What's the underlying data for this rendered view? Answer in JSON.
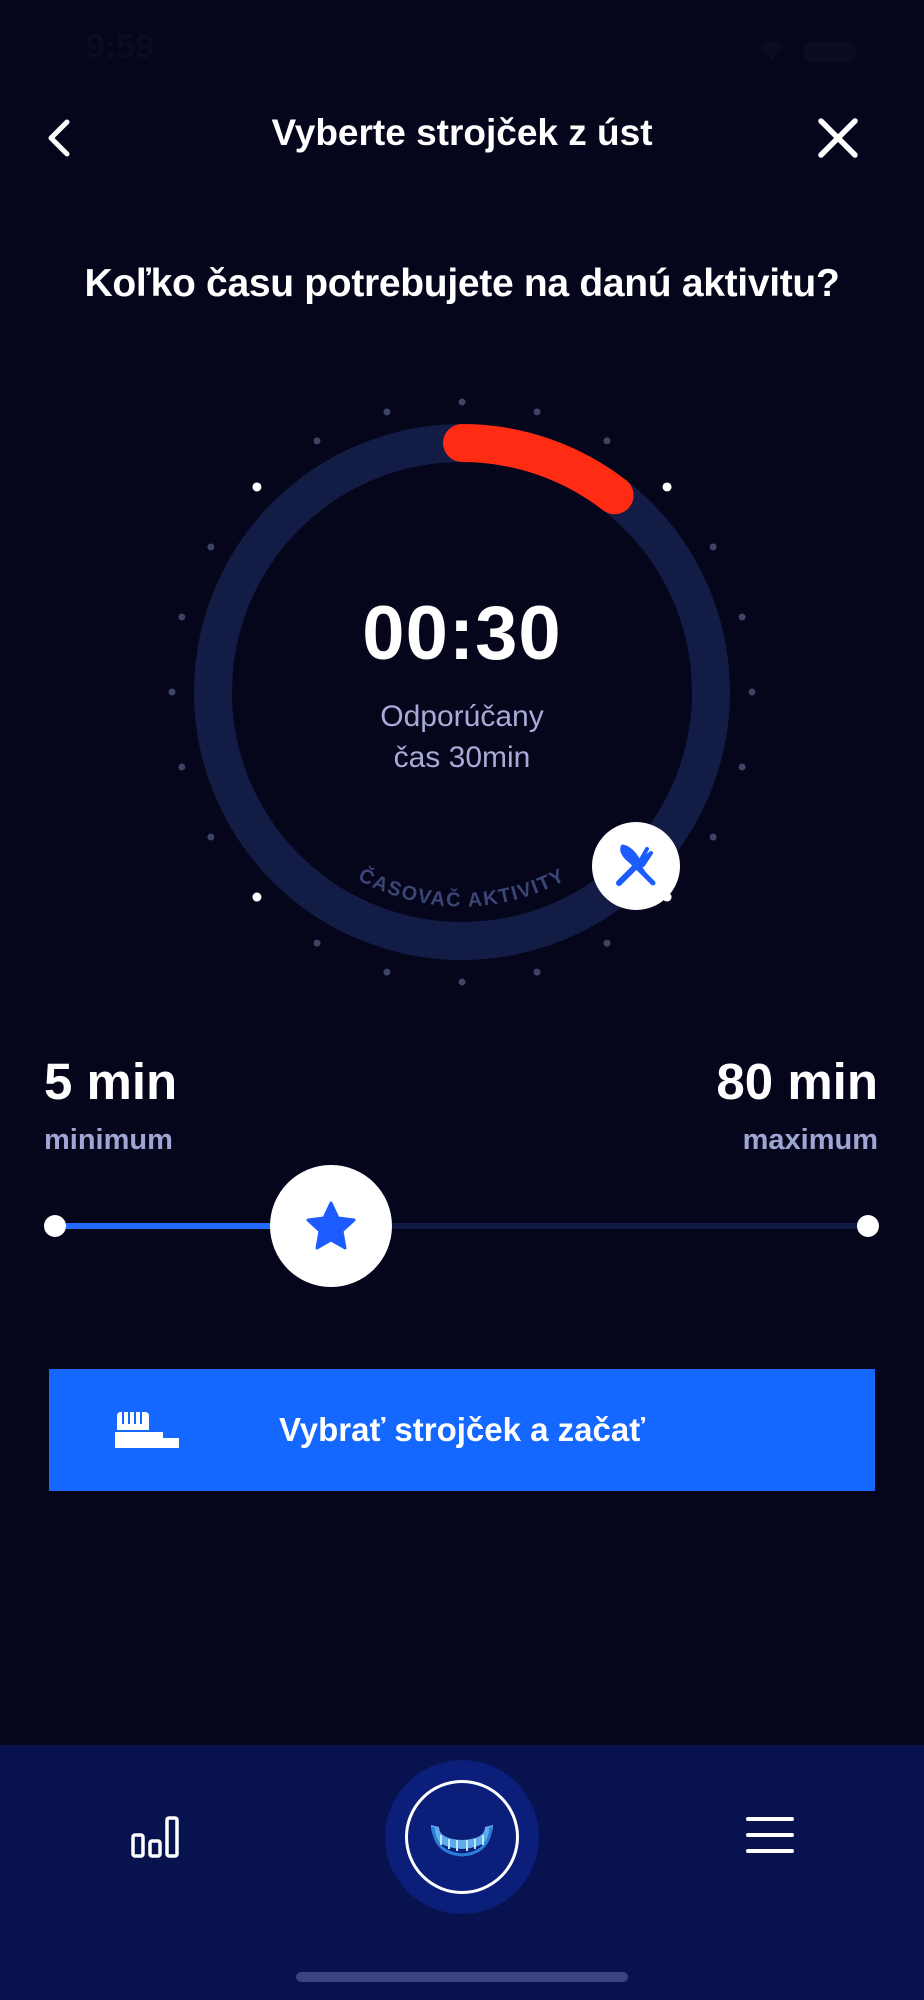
{
  "status_bar": {
    "time": "9:59"
  },
  "header": {
    "title": "Vyberte strojček z úst"
  },
  "question": "Koľko času potrebujete na danú aktivitu?",
  "timer": {
    "display": "00:30",
    "recommended_line1": "Odporúčany",
    "recommended_line2": "čas 30min",
    "ring_label": "ČASOVAČ AKTIVITY",
    "progress_fraction": 0.1,
    "track_color": "#131c44",
    "progress_color": "#ff2b12"
  },
  "range": {
    "min_value": "5 min",
    "min_label": "minimum",
    "max_value": "80 min",
    "max_label": "maximum",
    "slider_fraction": 0.34
  },
  "action_button": {
    "label": "Vybrať strojček a začať",
    "color": "#1467ff"
  },
  "icons": {
    "back": "chevron-left-icon",
    "close": "close-icon",
    "activity": "fork-knife-icon",
    "slider_thumb": "star-icon",
    "button": "toothbrush-icon",
    "nav_left": "bar-chart-icon",
    "nav_center": "aligner-icon",
    "nav_right": "menu-icon"
  }
}
